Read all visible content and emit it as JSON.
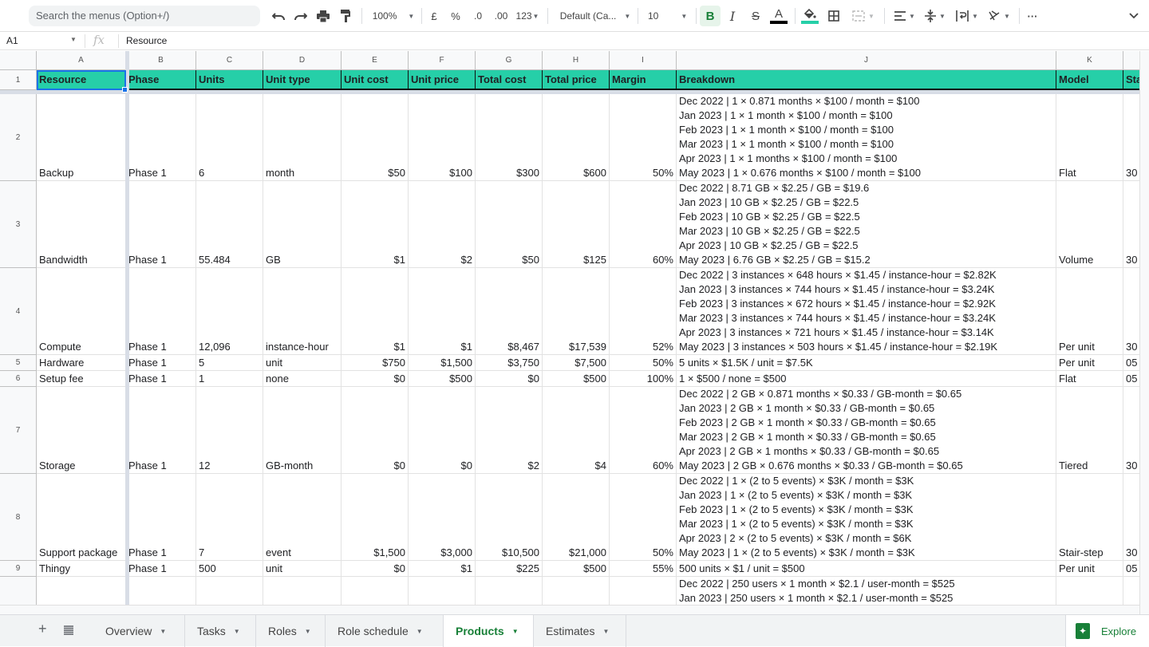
{
  "toolbar": {
    "search_placeholder": "Search the menus (Option+/)",
    "zoom": "100%",
    "currency": "£",
    "percent": "%",
    "dec_decrease": ".0",
    "dec_increase": ".00",
    "number_format": "123",
    "font": "Default (Ca...",
    "font_size": "10",
    "bold": "B",
    "italic": "I",
    "strike": "S",
    "text_color_letter": "A",
    "text_color": "#000000",
    "fill_color": "#26cfa8",
    "more": "···"
  },
  "formula_bar": {
    "cell_ref": "A1",
    "fx": "fx",
    "value": "Resource"
  },
  "columns": [
    "A",
    "B",
    "C",
    "D",
    "E",
    "F",
    "G",
    "H",
    "I",
    "J",
    "K",
    ""
  ],
  "header_row": {
    "row_number": "1",
    "cells": [
      "Resource",
      "Phase",
      "Units",
      "Unit type",
      "Unit cost",
      "Unit price",
      "Total cost",
      "Total price",
      "Margin",
      "Breakdown",
      "Model",
      "Sta"
    ]
  },
  "rows": [
    {
      "n": "2",
      "resource": "Backup",
      "phase": "Phase 1",
      "units": "6",
      "unit_type": "month",
      "unit_cost": "$50",
      "unit_price": "$100",
      "total_cost": "$300",
      "total_price": "$600",
      "margin": "50%",
      "model": "Flat",
      "start": "30",
      "breakdown": [
        "Dec 2022 | 1 × 0.871 months × $100 / month = $100",
        "Jan 2023 | 1 × 1 month × $100 / month = $100",
        "Feb 2023 | 1 × 1 month × $100 / month = $100",
        "Mar 2023 | 1 × 1 month × $100 / month = $100",
        "Apr 2023 | 1 × 1 months × $100 / month = $100",
        "May 2023 | 1 × 0.676 months × $100 / month = $100"
      ]
    },
    {
      "n": "3",
      "resource": "Bandwidth",
      "phase": "Phase 1",
      "units": "55.484",
      "unit_type": "GB",
      "unit_cost": "$1",
      "unit_price": "$2",
      "total_cost": "$50",
      "total_price": "$125",
      "margin": "60%",
      "model": "Volume",
      "start": "30",
      "breakdown": [
        "Dec 2022 | 8.71 GB × $2.25 / GB = $19.6",
        "Jan 2023 | 10 GB × $2.25 / GB = $22.5",
        "Feb 2023 | 10 GB × $2.25 / GB = $22.5",
        "Mar 2023 | 10 GB × $2.25 / GB = $22.5",
        "Apr 2023 | 10 GB × $2.25 / GB = $22.5",
        "May 2023 | 6.76 GB × $2.25 / GB = $15.2"
      ]
    },
    {
      "n": "4",
      "resource": "Compute",
      "phase": "Phase 1",
      "units": "12,096",
      "unit_type": "instance-hour",
      "unit_cost": "$1",
      "unit_price": "$1",
      "total_cost": "$8,467",
      "total_price": "$17,539",
      "margin": "52%",
      "model": "Per unit",
      "start": "30",
      "breakdown": [
        "Dec 2022 | 3 instances × 648 hours × $1.45 / instance-hour = $2.82K",
        "Jan 2023 | 3 instances × 744 hours × $1.45 / instance-hour = $3.24K",
        "Feb 2023 | 3 instances × 672 hours × $1.45 / instance-hour = $2.92K",
        "Mar 2023 | 3 instances × 744 hours × $1.45 / instance-hour = $3.24K",
        "Apr 2023 | 3 instances × 721 hours × $1.45 / instance-hour = $3.14K",
        "May 2023 | 3 instances × 503 hours × $1.45 / instance-hour = $2.19K"
      ]
    },
    {
      "n": "5",
      "resource": "Hardware",
      "phase": "Phase 1",
      "units": "5",
      "unit_type": "unit",
      "unit_cost": "$750",
      "unit_price": "$1,500",
      "total_cost": "$3,750",
      "total_price": "$7,500",
      "margin": "50%",
      "model": "Per unit",
      "start": "05",
      "breakdown": [
        "5 units × $1.5K / unit = $7.5K"
      ]
    },
    {
      "n": "6",
      "resource": "Setup fee",
      "phase": "Phase 1",
      "units": "1",
      "unit_type": "none",
      "unit_cost": "$0",
      "unit_price": "$500",
      "total_cost": "$0",
      "total_price": "$500",
      "margin": "100%",
      "model": "Flat",
      "start": "05",
      "breakdown": [
        "1 × $500 / none = $500"
      ]
    },
    {
      "n": "7",
      "resource": "Storage",
      "phase": "Phase 1",
      "units": "12",
      "unit_type": "GB-month",
      "unit_cost": "$0",
      "unit_price": "$0",
      "total_cost": "$2",
      "total_price": "$4",
      "margin": "60%",
      "model": "Tiered",
      "start": "30",
      "breakdown": [
        "Dec 2022 | 2 GB × 0.871 months × $0.33 / GB-month = $0.65",
        "Jan 2023 | 2 GB × 1 month × $0.33 / GB-month = $0.65",
        "Feb 2023 | 2 GB × 1 month × $0.33 / GB-month = $0.65",
        "Mar 2023 | 2 GB × 1 month × $0.33 / GB-month = $0.65",
        "Apr 2023 | 2 GB × 1 months × $0.33 / GB-month = $0.65",
        "May 2023 | 2 GB × 0.676 months × $0.33 / GB-month = $0.65"
      ]
    },
    {
      "n": "8",
      "resource": "Support package",
      "phase": "Phase 1",
      "units": "7",
      "unit_type": "event",
      "unit_cost": "$1,500",
      "unit_price": "$3,000",
      "total_cost": "$10,500",
      "total_price": "$21,000",
      "margin": "50%",
      "model": "Stair-step",
      "start": "30",
      "breakdown": [
        "Dec 2022 | 1 × (2 to 5 events) × $3K / month = $3K",
        "Jan 2023 | 1 × (2 to 5 events) × $3K / month = $3K",
        "Feb 2023 | 1 × (2 to 5 events) × $3K / month = $3K",
        "Mar 2023 | 1 × (2 to 5 events) × $3K / month = $3K",
        "Apr 2023 | 2 × (2 to 5 events) × $3K / month = $6K",
        "May 2023 | 1 × (2 to 5 events) × $3K / month = $3K"
      ]
    },
    {
      "n": "9",
      "resource": "Thingy",
      "phase": "Phase 1",
      "units": "500",
      "unit_type": "unit",
      "unit_cost": "$0",
      "unit_price": "$1",
      "total_cost": "$225",
      "total_price": "$500",
      "margin": "55%",
      "model": "Per unit",
      "start": "05",
      "breakdown": [
        "500 units × $1 / unit = $500"
      ]
    },
    {
      "n": "",
      "resource": "",
      "phase": "",
      "units": "",
      "unit_type": "",
      "unit_cost": "",
      "unit_price": "",
      "total_cost": "",
      "total_price": "",
      "margin": "",
      "model": "",
      "start": "",
      "breakdown": [
        "Dec 2022 | 250 users × 1 month × $2.1 / user-month = $525",
        "Jan 2023 | 250 users × 1 month × $2.1 / user-month = $525"
      ],
      "partial": true
    }
  ],
  "sheet_tabs": [
    {
      "label": "Overview",
      "active": false
    },
    {
      "label": "Tasks",
      "active": false
    },
    {
      "label": "Roles",
      "active": false
    },
    {
      "label": "Role schedule",
      "active": false
    },
    {
      "label": "Products",
      "active": true
    },
    {
      "label": "Estimates",
      "active": false
    }
  ],
  "explore_label": "Explore",
  "colors": {
    "header_fill": "#26cfa8",
    "selection": "#1a73e8",
    "active_tab": "#188038"
  }
}
